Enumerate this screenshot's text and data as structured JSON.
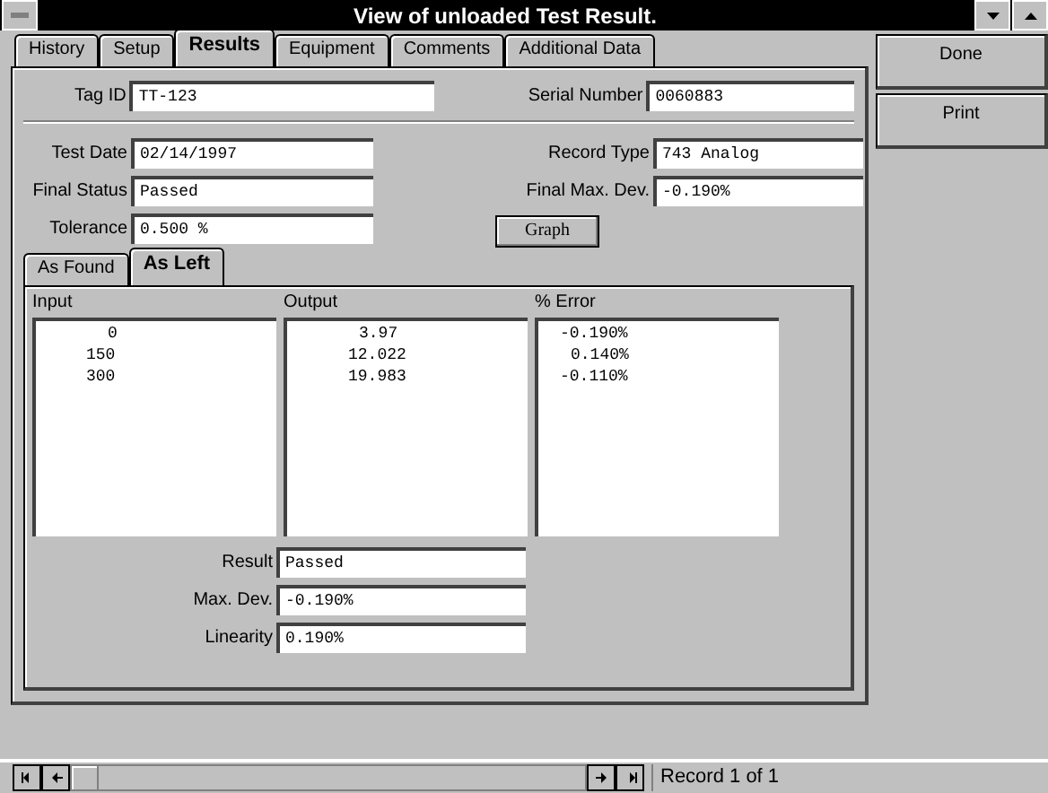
{
  "window": {
    "title": "View of unloaded Test Result."
  },
  "tabs": [
    {
      "label": "History",
      "selected": false
    },
    {
      "label": "Setup",
      "selected": false
    },
    {
      "label": "Results",
      "selected": true
    },
    {
      "label": "Equipment",
      "selected": false
    },
    {
      "label": "Comments",
      "selected": false
    },
    {
      "label": "Additional Data",
      "selected": false
    }
  ],
  "header_fields": [
    {
      "label": "Tag ID",
      "value": "TT-123"
    },
    {
      "label": "Serial Number",
      "value": "0060883"
    }
  ],
  "left_fields": [
    {
      "label": "Test Date",
      "value": "02/14/1997"
    },
    {
      "label": "Final Status",
      "value": "Passed"
    },
    {
      "label": "Tolerance",
      "value": "0.500 %"
    }
  ],
  "right_fields": [
    {
      "label": "Record Type",
      "value": "743 Analog"
    },
    {
      "label": "Final Max. Dev.",
      "value": "-0.190%"
    }
  ],
  "graph_button": "Graph",
  "sub_tabs": [
    {
      "label": "As Found",
      "selected": false
    },
    {
      "label": "As Left",
      "selected": true
    }
  ],
  "lists": [
    {
      "header": "Input",
      "rows": [
        "0",
        "150",
        "300"
      ]
    },
    {
      "header": "Output",
      "rows": [
        "3.97",
        "12.022",
        "19.983"
      ]
    },
    {
      "header": "% Error",
      "rows": [
        "-0.190%",
        "0.140%",
        "-0.110%"
      ]
    }
  ],
  "result_fields": [
    {
      "label": "Result",
      "value": "Passed"
    },
    {
      "label": "Max. Dev.",
      "value": "-0.190%"
    },
    {
      "label": "Linearity",
      "value": "0.190%"
    }
  ],
  "buttons": [
    "Done",
    "Print"
  ],
  "status_bar": {
    "record": "Record 1 of 1"
  }
}
